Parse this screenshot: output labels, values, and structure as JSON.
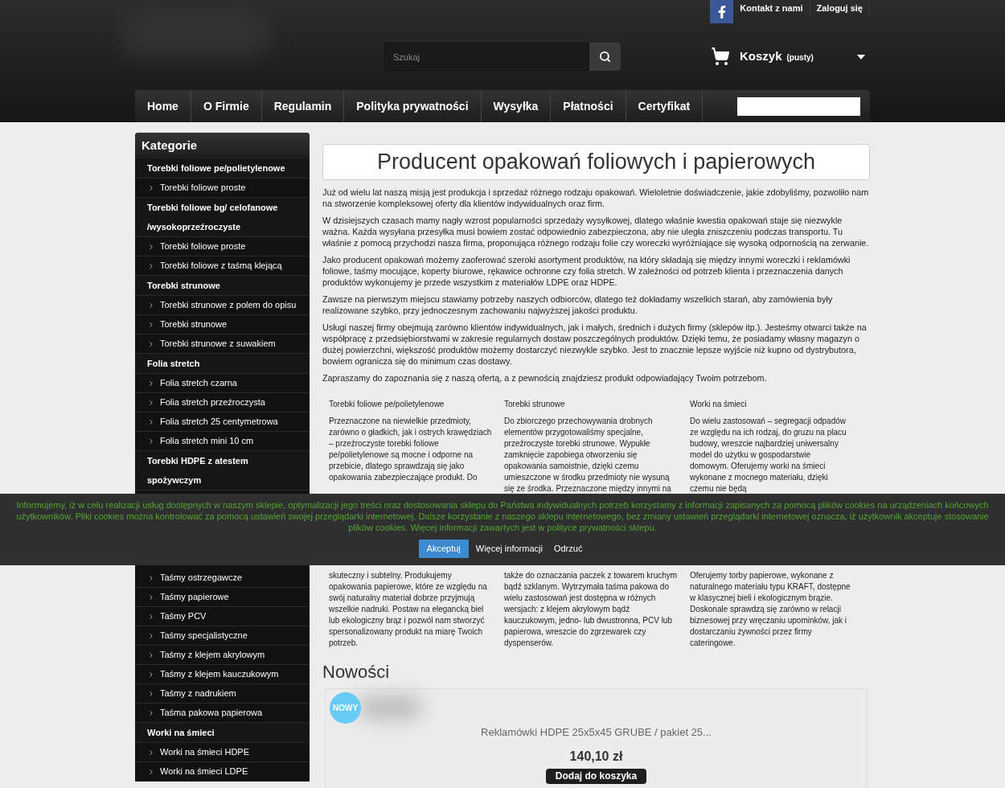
{
  "header": {
    "top_links": [
      "Kontakt z nami",
      "Zaloguj się"
    ],
    "search": {
      "placeholder": "Szukaj"
    },
    "cart": {
      "label": "Koszyk",
      "status": "(pusty)"
    }
  },
  "nav": {
    "items": [
      "Home",
      "O Firmie",
      "Regulamin",
      "Polityka prywatności",
      "Wysyłka",
      "Płatności",
      "Certyfikat"
    ]
  },
  "sidebar": {
    "title": "Kategorie",
    "categories": [
      {
        "label": "Torebki foliowe pe/polietylenowe",
        "children": [
          {
            "label": "Torebki foliowe proste"
          }
        ]
      },
      {
        "label": "Torebki foliowe bg/ celofanowe /wysokoprzeźroczyste",
        "children": [
          {
            "label": "Torebki foliowe proste"
          },
          {
            "label": "Torebki foliowe z taśmą klejącą"
          }
        ]
      },
      {
        "label": "Torebki strunowe",
        "children": [
          {
            "label": "Torebki strunowe z polem do opisu"
          },
          {
            "label": "Torebki strunowe"
          },
          {
            "label": "Torebki strunowe z suwakiem"
          }
        ]
      },
      {
        "label": "Folia stretch",
        "children": [
          {
            "label": "Folia stretch czarna"
          },
          {
            "label": "Folia stretch przeźroczysta"
          },
          {
            "label": "Folia stretch 25 centymetrowa"
          },
          {
            "label": "Folia stretch mini 10 cm"
          }
        ]
      },
      {
        "label": "Torebki HDPE z atestem spożywczym"
      }
    ],
    "categories_below_banner": [
      {
        "children": [
          {
            "label": "Taśmy ostrzegawcze"
          },
          {
            "label": "Taśmy papierowe"
          },
          {
            "label": "Taśmy PCV"
          },
          {
            "label": "Taśmy specjalistyczne"
          },
          {
            "label": "Taśmy z klejem akrylowym"
          },
          {
            "label": "Taśmy z klejem kauczukowym"
          },
          {
            "label": "Taśmy z nadrukiem"
          },
          {
            "label": "Taśma pakowa papierowa"
          }
        ]
      },
      {
        "label": "Worki na śmieci",
        "children": [
          {
            "label": "Worki na śmieci HDPE"
          },
          {
            "label": "Worki na śmieci LDPE"
          }
        ]
      }
    ]
  },
  "main": {
    "title": "Producent opakowań foliowych i papierowych",
    "paragraphs": [
      "Już od wielu lat naszą misją jest produkcja i sprzedaż różnego rodzaju opakowań. Wieloletnie doświadczenie, jakie zdobyliśmy, pozwoliło nam na stworzenie kompleksowej oferty dla klientów indywidualnych oraz firm.",
      "W dzisiejszych czasach mamy nagły wzrost popularności sprzedaży wysyłkowej, dlatego właśnie kwestia opakowań staje się niezwykle ważna. Każda wysyłana przesyłka musi bowiem zostać odpowiednio zabezpieczona, aby nie uległa zniszczeniu podczas transportu. Tu właśnie z pomocą przychodzi nasza firma, proponująca różnego rodzaju folie czy woreczki wyróżniające się wysoką odpornością na zerwanie.",
      "Jako producent opakowań możemy zaoferować szeroki asortyment produktów, na który składają się między innymi woreczki i reklamówki foliowe, taśmy mocujące, koperty biurowe, rękawice ochronne czy folia stretch. W zależności od potrzeb klienta i przeznaczenia danych produktów wykonujemy je przede wszystkim z materiałów LDPE oraz HDPE.",
      "Zawsze na pierwszym miejscu stawiamy potrzeby naszych odbiorców, dlatego też dokładamy wszelkich starań, aby zamówienia były realizowane szybko, przy jednoczesnym zachowaniu najwyższej jakości produktu.",
      "Usługi naszej firmy obejmują zarówno klientów indywidualnych, jak i małych, średnich i dużych firmy (sklepów itp.). Jesteśmy otwarci także na współpracę z przedsiębiorstwami w zakresie regularnych dostaw poszczególnych produktów. Dzięki temu, że posiadamy własny magazyn o dużej powierzchni, większość produktów możemy dostarczyć niezwykle szybko. Jest to znacznie lepsze wyjście niż kupno od dystrybutora, bowiem ogranicza się do minimum czas dostawy.",
      "Zapraszamy do zapoznania się z naszą ofertą, a z pewnością znajdziesz produkt odpowiadający Twoim potrzebom."
    ],
    "features": [
      {
        "title": "Torebki foliowe pe/polietylenowe",
        "text": "Przeznaczone na niewielkie przedmioty, zarówno o gładkich, jak i ostrych krawędziach – przeźroczyste torebki foliowe pe/polietylenowe są mocne i odporne na przebicie, dlatego sprawdzają się jako opakowania zabezpieczające produkt. Do"
      },
      {
        "title": "Torebki strunowe",
        "text": "Do zbiorczego przechowywania drobnych elementów przygotowaliśmy specjalne, przeźroczyste torebki strunowe. Wypukłe zamknięcie zapobiega otworzeniu się opakowania samoistnie, dzięki czemu umieszczone w środku przedmioty nie wysuną się ze środka. Przeznaczone między innymi na"
      },
      {
        "title": "Worki na śmieci",
        "text": "Do wielu zastosowań – segregacji odpadów ze względu na ich rodzaj, do gruzu na placu budowy, wreszcie najbardziej uniwersalny model do użytku w gospodarstwie domowym. Oferujemy worki na śmieci wykonane z mocnego materiału, dzięki czemu nie będą"
      }
    ],
    "features_below_banner": [
      {
        "text": "skuteczny i subtelny. Produkujemy opakowania papierowe, które ze względu na swój naturalny materiał dobrze przyjmują wszelkie nadruki. Postaw na elegancką biel lub ekologiczny brąz i pozwól nam stworzyć spersonalizowany produkt na miarę Twoich potrzeb."
      },
      {
        "text": "także do oznaczania paczek z towarem kruchym bądź szklanym. Wytrzymała taśma pakowa do wielu zastosowań jest dostępna w różnych wersjach: z klejem akrylowym bądź kauczukowym, jedno- lub dwustronna, PCV lub papierowa, wreszcie do zgrzewarek czy dyspenserów."
      },
      {
        "text": "Oferujemy torby papierowe, wykonane z naturalnego materiału typu KRAFT, dostępne w klasycznej bieli i ekologicznym brązie. Doskonale sprawdzą się zarówno w relacji biznesowej przy wręczaniu upominków, jak i dostarczaniu żywności przez firmy cateringowe."
      }
    ],
    "news": {
      "title": "Nowości",
      "products": [
        {
          "badge": "NOWY",
          "name": "Reklamówki HDPE 25x5x45 GRUBE / pakiet 25...",
          "price": "140,10 zł",
          "button": "Dodaj do koszyka"
        }
      ]
    }
  },
  "cookie_banner": {
    "text": "Informujemy, iż w celu realizacji usług dostępnych w naszym sklepie, optymalizacji jego treści oraz dostosowania sklepu do Państwa indywidualnych potrzeb korzystamy z informacji zapisanych za pomocą plików cookies na urządzeniach końcowych użytkowników. Pliki cookies można kontrolować za pomocą ustawień swojej przeglądarki internetowej. Dalsze korzystanie z naszego sklepu internetowego, bez zmiany ustawień przeglądarki internetowej oznacza, iż użytkownik akceptuje stosowanie plików cookies. Więcej informacji zawartych jest w polityce prywatności sklepu.",
    "buttons": [
      {
        "label": "Akceptuj",
        "kind": "primary"
      },
      {
        "label": "Więcej informacji",
        "kind": "link"
      },
      {
        "label": "Odrzuć",
        "kind": "link"
      }
    ]
  }
}
